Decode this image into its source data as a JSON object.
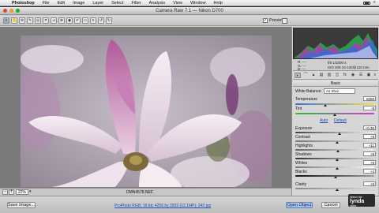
{
  "menubar": {
    "app_name": "Photoshop",
    "menus": [
      "File",
      "Edit",
      "Image",
      "Layer",
      "Select",
      "Filter",
      "Analysis",
      "View",
      "Window",
      "Help"
    ]
  },
  "window": {
    "title": "Camera Raw 7.1  —  Nikon D700"
  },
  "toolbar": {
    "preview_label": "Preview",
    "preview_checked": "✓"
  },
  "zoombar": {
    "zoom_value": "22%",
    "filename": "DMN4578.NEF"
  },
  "histogram": {
    "rgb_lines": [
      "R:  ---",
      "G:  ---",
      "B:  ---"
    ],
    "meta1": "f/8   1/1000 s",
    "meta2": "ISO 200   24-120@120 mm"
  },
  "basic_panel": {
    "section_title": "Basic",
    "white_balance_label": "White Balance:",
    "white_balance_value": "As Shot",
    "temperature_label": "Temperature",
    "temperature_value": "6050",
    "tint_label": "Tint",
    "tint_value": "-8",
    "auto_label": "Auto",
    "default_label": "Default",
    "exposure_label": "Exposure",
    "exposure_value": "+0.35",
    "contrast_label": "Contrast",
    "contrast_value": "+9",
    "highlights_label": "Highlights",
    "highlights_value": "+11",
    "shadows_label": "Shadows",
    "shadows_value": "+8",
    "whites_label": "Whites",
    "whites_value": "+9",
    "blacks_label": "Blacks",
    "blacks_value": "+4",
    "clarity_label": "Clarity",
    "clarity_value": "+8"
  },
  "bottombar": {
    "save_image_label": "Save Image...",
    "workflow_link": "ProPhoto RGB; 16 bit; 4256 by 2832 (12.1MP); 240 ppi",
    "open_object_label": "Open Object",
    "cancel_label": "Cancel",
    "done_label": "Done"
  },
  "watermark": {
    "line1": "Watch the",
    "line2": "lynda",
    "line3": "video"
  },
  "colors": {
    "accent_blue": "#8db6ee",
    "histogram_bg": "#3a3a3a"
  }
}
